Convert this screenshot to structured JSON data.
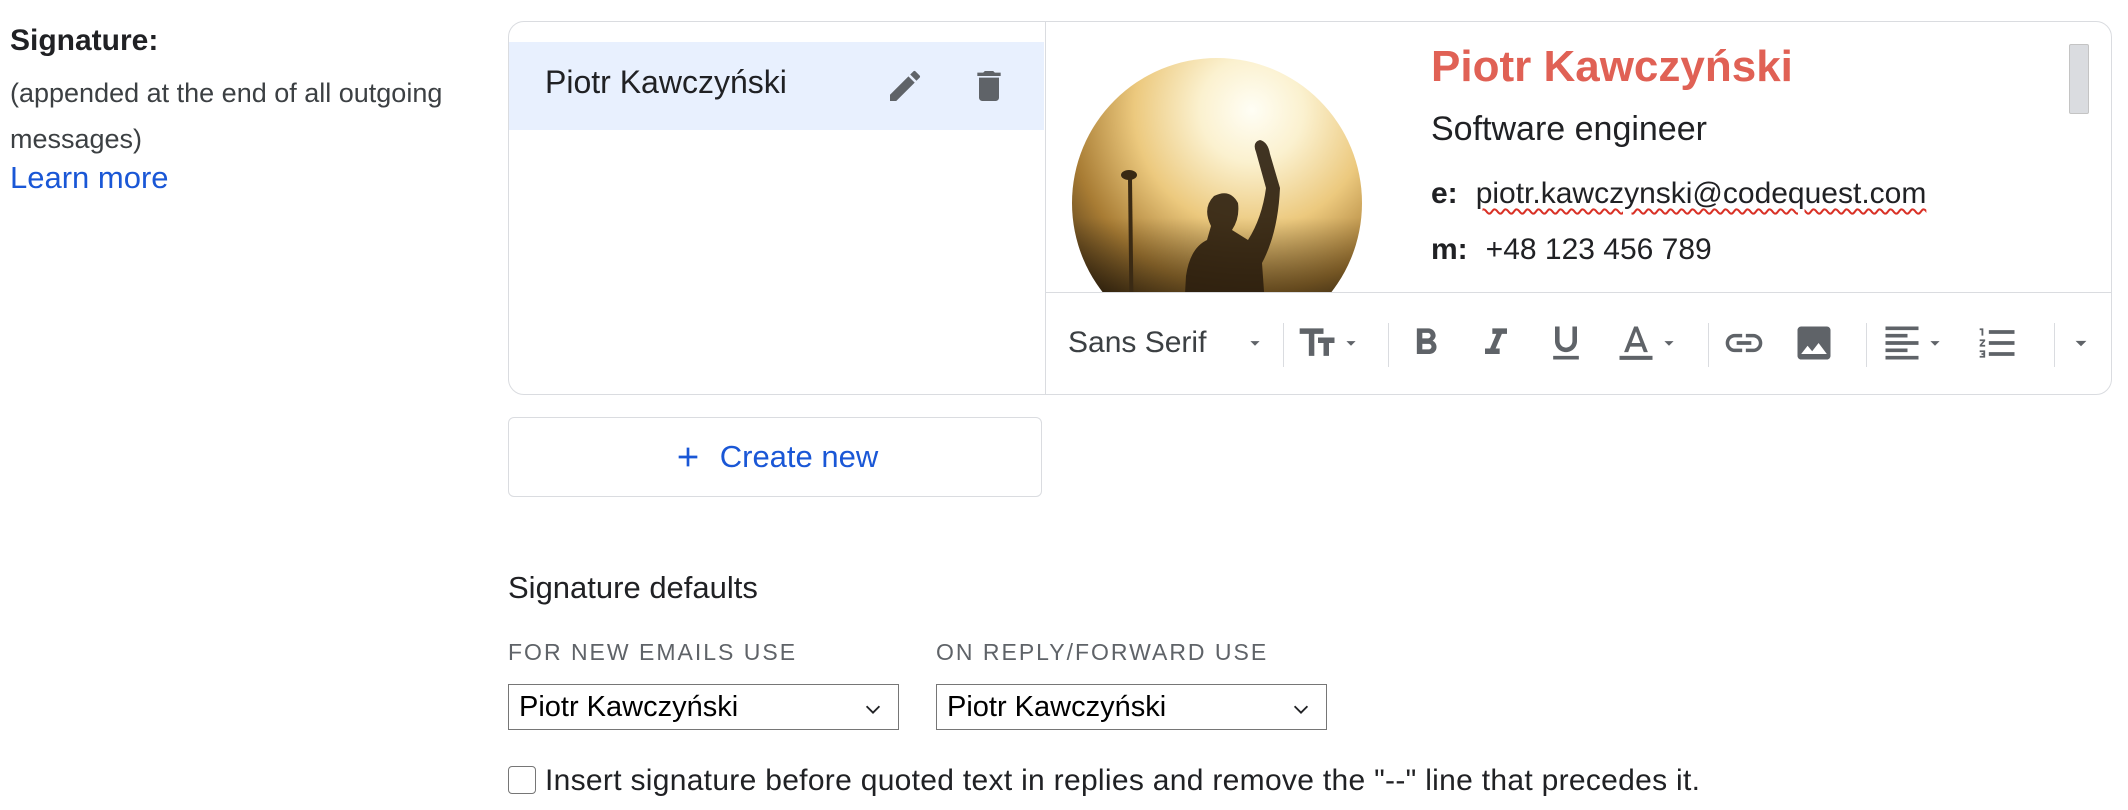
{
  "signature_section": {
    "title": "Signature:",
    "description": "(appended at the end of all outgoing messages)",
    "learn_more": "Learn more"
  },
  "signature_list": {
    "items": [
      {
        "name": "Piotr Kawczyński",
        "selected": true
      }
    ]
  },
  "signature_content": {
    "name": "Piotr Kawczyński",
    "role": "Software engineer",
    "email_label": "e:",
    "email": "piotr.kawczynski@codequest.com",
    "phone_label": "m:",
    "phone": "+48 123 456 789",
    "name_color": "#e06155"
  },
  "toolbar": {
    "font": "Sans Serif",
    "buttons": [
      "text-size-icon",
      "bold-icon",
      "italic-icon",
      "underline-icon",
      "text-color-icon",
      "link-icon",
      "image-icon",
      "align-icon",
      "numbered-list-icon",
      "more-icon"
    ]
  },
  "create_new": {
    "label": "Create new"
  },
  "defaults": {
    "title": "Signature defaults",
    "new_emails_label": "FOR NEW EMAILS USE",
    "new_emails_value": "Piotr Kawczyński",
    "reply_label": "ON REPLY/FORWARD USE",
    "reply_value": "Piotr Kawczyński",
    "insert_checkbox_label": "Insert signature before quoted text in replies and remove the \"--\" line that precedes it.",
    "insert_checked": false
  },
  "colors": {
    "accent": "#1a57d6",
    "selected_bg": "#e8f0fe",
    "border": "#dadce0"
  }
}
